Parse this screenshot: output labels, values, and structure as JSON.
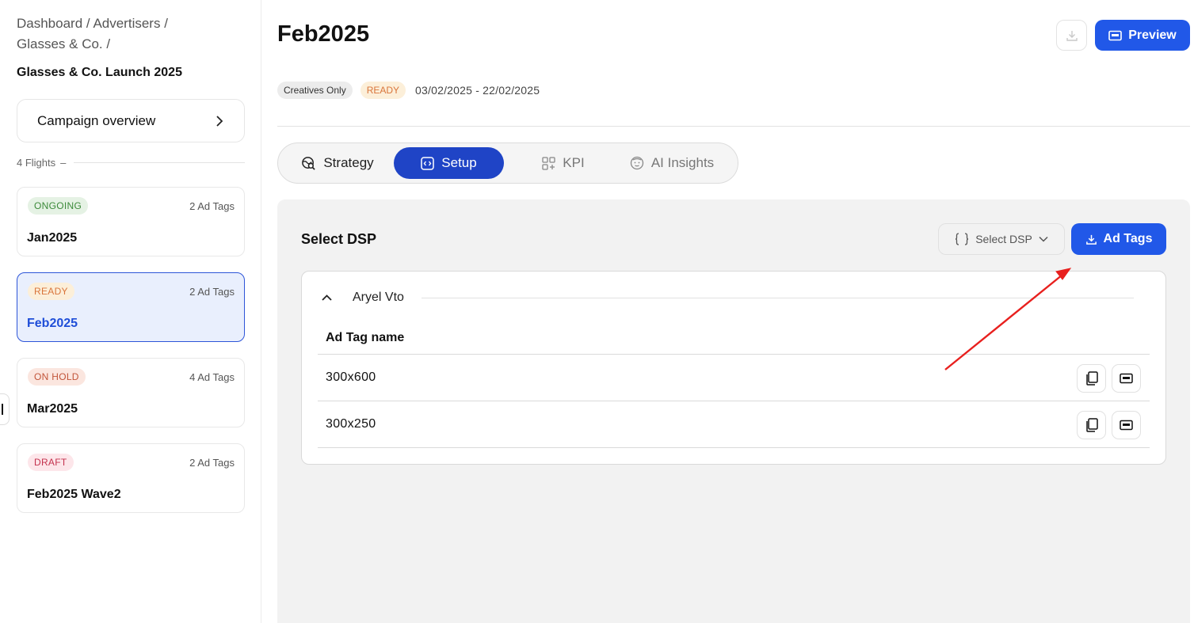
{
  "breadcrumb": {
    "dashboard": "Dashboard",
    "advertisers": "Advertisers",
    "advertiser": "Glasses & Co.",
    "sep": "/"
  },
  "campaign": {
    "title": "Glasses & Co. Launch 2025",
    "overview_label": "Campaign overview"
  },
  "flights": {
    "header": "4 Flights",
    "items": [
      {
        "status": "ONGOING",
        "tags": "2 Ad Tags",
        "name": "Jan2025"
      },
      {
        "status": "READY",
        "tags": "2 Ad Tags",
        "name": "Feb2025"
      },
      {
        "status": "ON HOLD",
        "tags": "4 Ad Tags",
        "name": "Mar2025"
      },
      {
        "status": "DRAFT",
        "tags": "2 Ad Tags",
        "name": "Feb2025 Wave2"
      }
    ]
  },
  "header": {
    "title": "Feb2025",
    "preview_label": "Preview",
    "type_chip": "Creatives Only",
    "status_chip": "READY",
    "date_range": "03/02/2025 - 22/02/2025"
  },
  "tabs": [
    {
      "label": "Strategy",
      "icon": "globe-search-icon"
    },
    {
      "label": "Setup",
      "icon": "code-square-icon"
    },
    {
      "label": "KPI",
      "icon": "grid-plus-icon"
    },
    {
      "label": "AI Insights",
      "icon": "face-icon"
    }
  ],
  "panel": {
    "title": "Select DSP",
    "dsp_placeholder": "Select DSP",
    "adtags_label": "Ad Tags",
    "group_name": "Aryel Vto",
    "column_header": "Ad Tag name",
    "rows": [
      {
        "name": "300x600"
      },
      {
        "name": "300x250"
      }
    ]
  },
  "colors": {
    "primary": "#2158e8",
    "active_tab": "#1f44c6",
    "annotation_arrow": "#e8201e"
  }
}
